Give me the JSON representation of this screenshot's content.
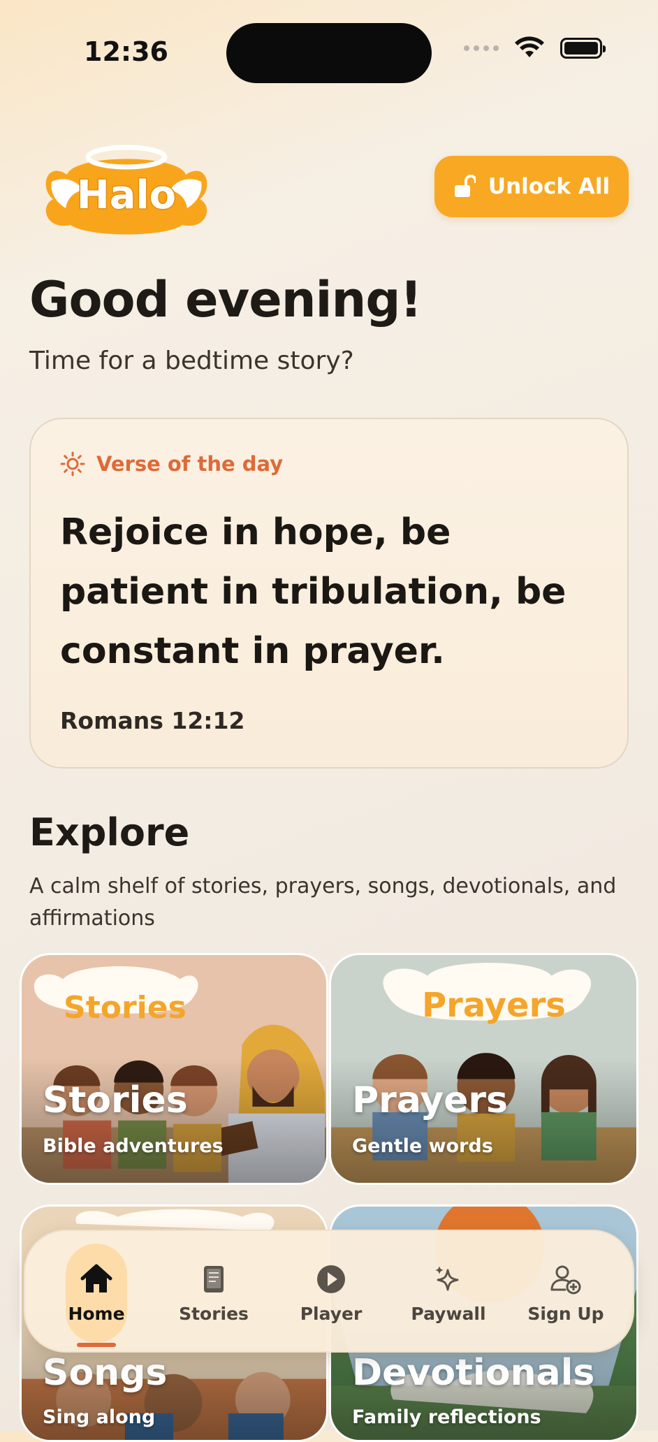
{
  "status_bar": {
    "time": "12:36"
  },
  "header": {
    "logo_text": "Halo",
    "unlock_label": "Unlock All"
  },
  "greeting": {
    "title": "Good evening!",
    "subtitle": "Time for a bedtime story?"
  },
  "verse": {
    "label": "Verse of the day",
    "text": "Rejoice in hope, be patient in tribulation, be constant in prayer.",
    "reference": "Romans 12:12"
  },
  "explore": {
    "title": "Explore",
    "subtitle": "A calm shelf of stories, prayers, songs, devotionals, and affirmations",
    "cards": [
      {
        "badge": "Stories",
        "title": "Stories",
        "subtitle": "Bible adventures"
      },
      {
        "badge": "Prayers",
        "title": "Prayers",
        "subtitle": "Gentle words"
      },
      {
        "badge": "",
        "title": "Songs",
        "subtitle": "Sing along"
      },
      {
        "badge": "",
        "title": "Devotionals",
        "subtitle": "Family reflections"
      }
    ]
  },
  "nav": {
    "items": [
      {
        "label": "Home",
        "icon": "home-icon",
        "active": true
      },
      {
        "label": "Stories",
        "icon": "book-icon",
        "active": false
      },
      {
        "label": "Player",
        "icon": "play-icon",
        "active": false
      },
      {
        "label": "Paywall",
        "icon": "sparkle-icon",
        "active": false
      },
      {
        "label": "Sign Up",
        "icon": "add-user-icon",
        "active": false
      }
    ]
  },
  "colors": {
    "accent": "#f8a823",
    "verse_label": "#de6a38",
    "nav_active_bg": "#fddcaa",
    "nav_underline": "#e0693a"
  }
}
